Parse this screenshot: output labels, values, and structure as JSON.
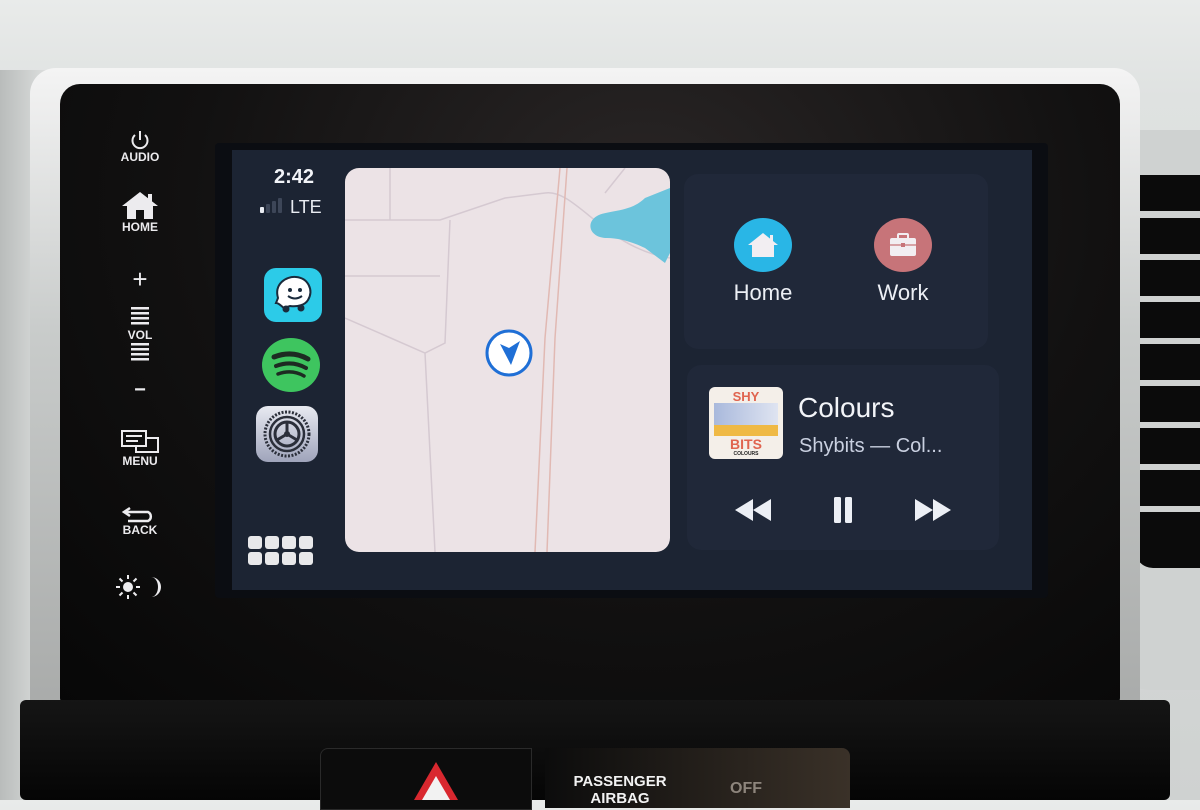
{
  "hardware_buttons": {
    "audio": "AUDIO",
    "home": "HOME",
    "volume_up": "+",
    "volume_label": "VOL",
    "volume_down": "−",
    "menu": "MENU",
    "back": "BACK"
  },
  "status_bar": {
    "time": "2:42",
    "network": "LTE",
    "signal_bars_on": 1,
    "signal_bars_total": 4
  },
  "dock_apps": [
    {
      "name": "Waze",
      "icon": "waze-icon"
    },
    {
      "name": "Spotify",
      "icon": "spotify-icon"
    },
    {
      "name": "Settings",
      "icon": "settings-gear-icon"
    }
  ],
  "map": {
    "location_marker": "current-location-arrow",
    "accent": "#1f6fd6",
    "water_color": "#6cc4dc"
  },
  "destinations": [
    {
      "label": "Home",
      "icon": "home-icon",
      "color": "#29b6e6"
    },
    {
      "label": "Work",
      "icon": "briefcase-icon",
      "color": "#c77479"
    }
  ],
  "now_playing": {
    "title": "Colours",
    "subtitle": "Shybits — Col...",
    "album_art": {
      "top": "SHY",
      "bottom": "BITS",
      "caption": "COLOURS"
    },
    "controls": [
      "rewind",
      "pause",
      "fast-forward"
    ]
  },
  "console": {
    "airbag_line1": "PASSENGER",
    "airbag_line2": "AIRBAG",
    "airbag_status": "OFF"
  }
}
